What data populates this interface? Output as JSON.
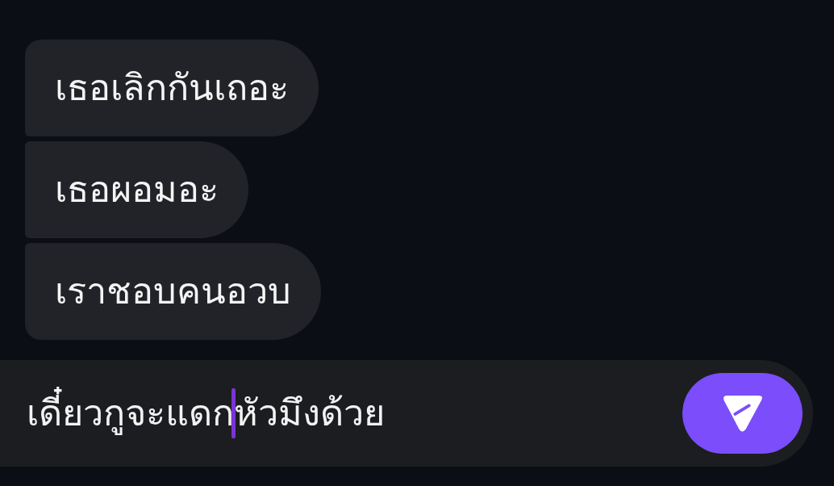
{
  "messages": [
    {
      "text": "เธอเลิกกันเถอะ"
    },
    {
      "text": "เธอผอมอะ"
    },
    {
      "text": "เราชอบคนอวบ"
    }
  ],
  "composer": {
    "text_before_caret": "เดี๋ยวกูจะแดก",
    "text_after_caret": "หัวมึงด้วย",
    "focused": true
  }
}
